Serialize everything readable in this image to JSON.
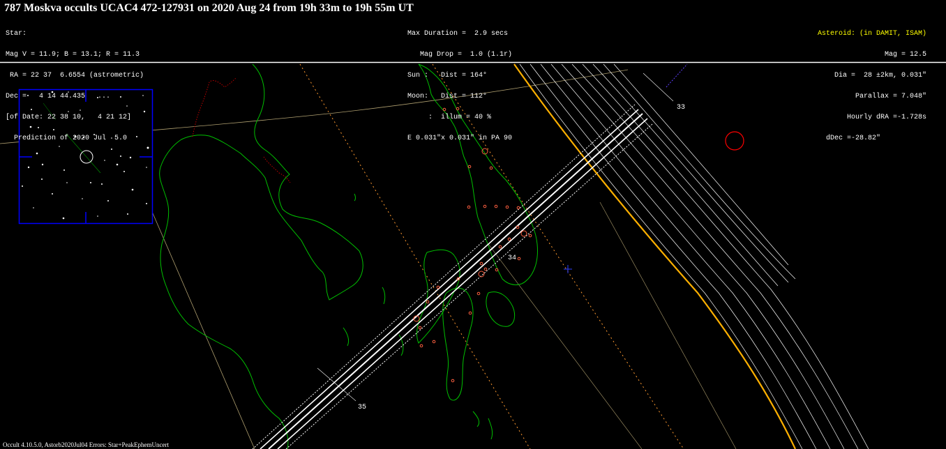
{
  "title": "787 Moskva occults UCAC4 472-127931 on 2020 Aug 24 from 19h 33m to 19h 55m UT",
  "star_info": [
    "Star:",
    "Mag V = 11.9; B = 13.1; R = 11.3",
    " RA = 22 37  6.6554 (astrometric)",
    "Dec =   4 14 44.435   ...",
    "[of Date: 22 38 10,   4 21 12]",
    "  Prediction of 2020 Jul  5.0"
  ],
  "event_info": [
    "Max Duration =  2.9 secs",
    "   Mag Drop =  1.0 (1.1r)",
    "Sun :   Dist = 164°",
    "Moon:   Dist = 112°",
    "     :  illum = 40 %",
    "E 0.031\"x 0.031\" in PA 90"
  ],
  "asteroid_info": {
    "header": "Asteroid: (in DAMIT, ISAM)",
    "lines": [
      "Mag = 12.5",
      "Dia =  28 ±2km, 0.031\"",
      "Parallax = 7.048\"",
      "Hourly dRA =-1.728s",
      "dDec =-28.82\""
    ]
  },
  "map_labels": {
    "label_33": "33",
    "label_34": "34",
    "label_35": "35"
  },
  "footer": "Occult 4.10.5.0, Astorb2020Jul04  Errors: Star+PeakEphemUncert",
  "colors": {
    "background": "#000000",
    "coastline": "#00c000",
    "border": "#c00000",
    "path_center": "#ffffff",
    "path_uncertainty": "#ffffff",
    "night_limit": "#ffb000",
    "sun_limit": "#c8a000",
    "finder_box": "#0000ff",
    "site_marker": "#ff6040",
    "moon_circle": "#ff0000",
    "sub_star_cross": "#0000ff"
  }
}
